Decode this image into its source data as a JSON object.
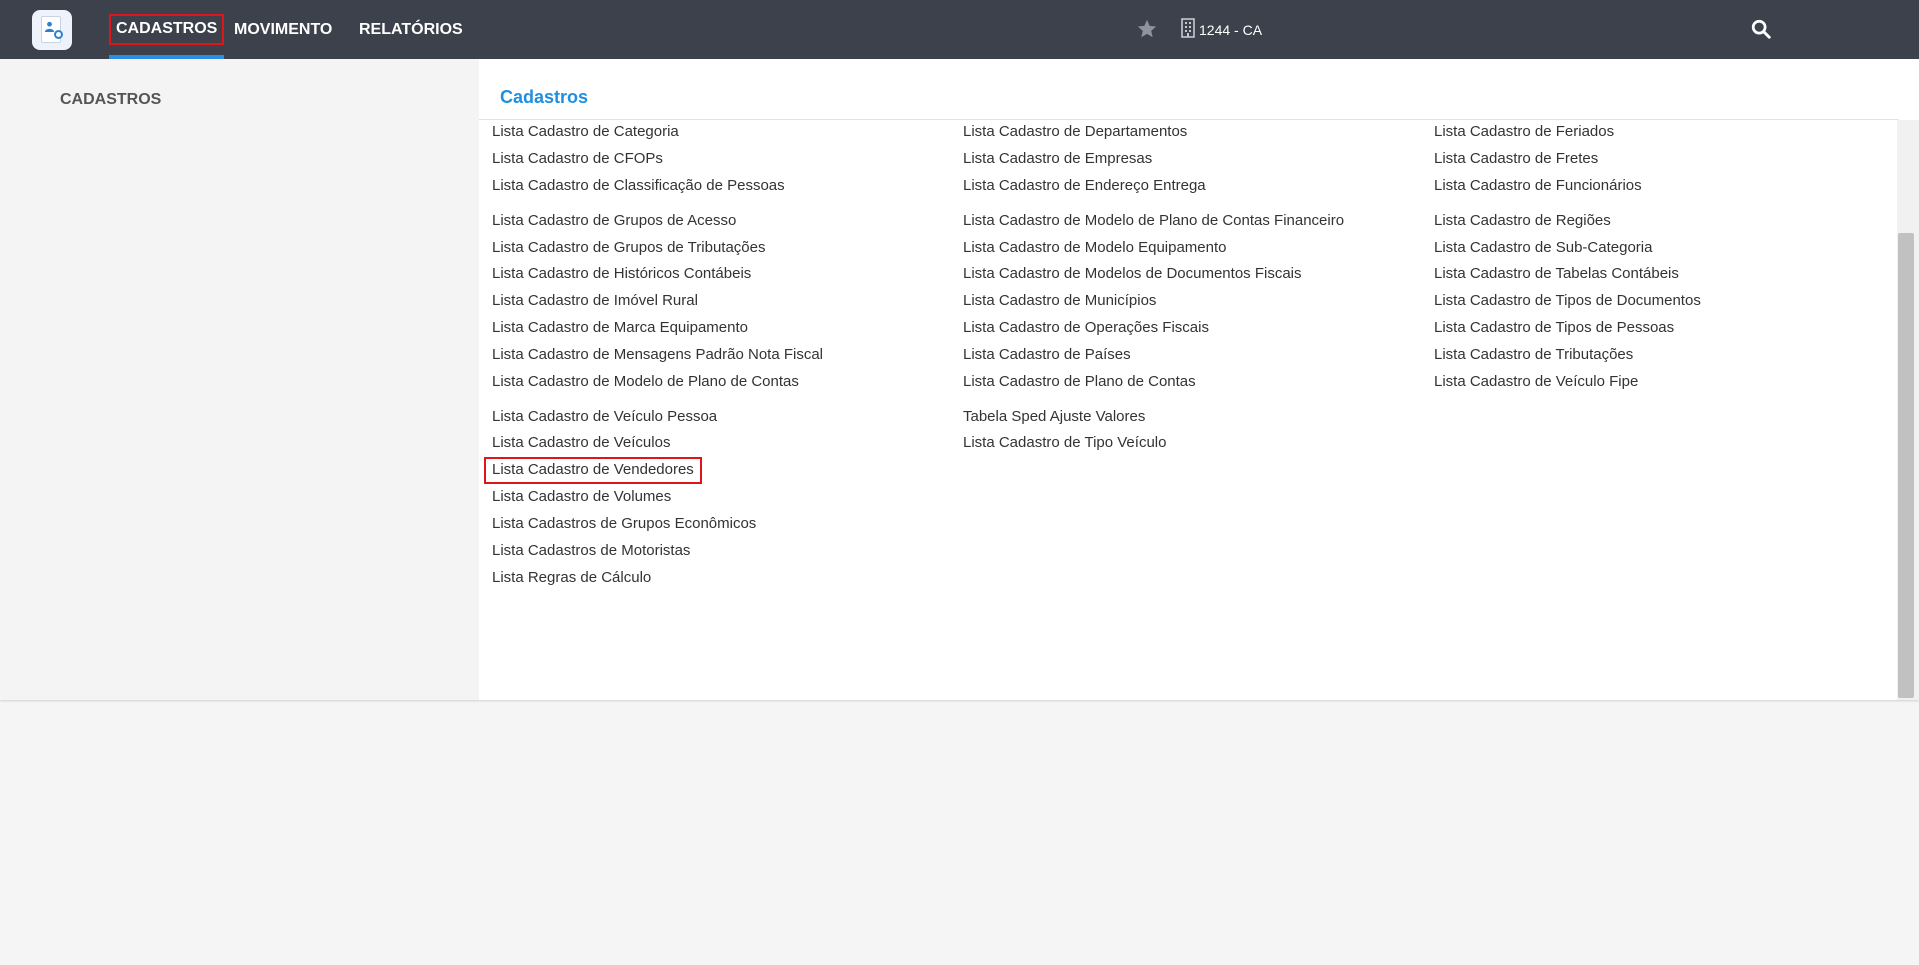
{
  "nav": {
    "items": [
      {
        "label": "CADASTROS"
      },
      {
        "label": "MOVIMENTO"
      },
      {
        "label": "RELATÓRIOS"
      }
    ],
    "company": "1244 - CA"
  },
  "menu": {
    "left_title": "CADASTROS",
    "section_title": "Cadastros",
    "col1": [
      "Lista Cadastro de Categoria",
      "Lista Cadastro de CFOPs",
      "Lista Cadastro de Classificação de Pessoas",
      "Lista Cadastro de Grupos de Acesso",
      "Lista Cadastro de Grupos de Tributações",
      "Lista Cadastro de Históricos Contábeis",
      "Lista Cadastro de Imóvel Rural",
      "Lista Cadastro de Marca Equipamento",
      "Lista Cadastro de Mensagens Padrão Nota Fiscal",
      "Lista Cadastro de Modelo de Plano de Contas",
      "Lista Cadastro de Veículo Pessoa",
      "Lista Cadastro de Veículos",
      "Lista Cadastro de Vendedores",
      "Lista Cadastro de Volumes",
      "Lista Cadastros de Grupos Econômicos",
      "Lista Cadastros de Motoristas",
      "Lista Regras de Cálculo"
    ],
    "col2": [
      "Lista Cadastro de Departamentos",
      "Lista Cadastro de Empresas",
      "Lista Cadastro de Endereço Entrega",
      "Lista Cadastro de Modelo de Plano de Contas Financeiro",
      "Lista Cadastro de Modelo Equipamento",
      "Lista Cadastro de Modelos de Documentos Fiscais",
      "Lista Cadastro de Municípios",
      "Lista Cadastro de Operações Fiscais",
      "Lista Cadastro de Países",
      "Lista Cadastro de Plano de Contas",
      "Tabela Sped Ajuste Valores",
      "Lista Cadastro de Tipo Veículo"
    ],
    "col3": [
      "Lista Cadastro de Feriados",
      "Lista Cadastro de Fretes",
      "Lista Cadastro de Funcionários",
      "Lista Cadastro de Regiões",
      "Lista Cadastro de Sub-Categoria",
      "Lista Cadastro de Tabelas Contábeis",
      "Lista Cadastro de Tipos de Documentos",
      "Lista Cadastro de Tipos de Pessoas",
      "Lista Cadastro de Tributações",
      "Lista Cadastro de Veículo Fipe"
    ]
  },
  "colors": {
    "topbar": "#3c414c",
    "accent": "#1f8fe0",
    "highlight": "#e0141b"
  },
  "icons": [
    "app-logo-icon",
    "star-icon",
    "building-icon",
    "search-icon"
  ]
}
